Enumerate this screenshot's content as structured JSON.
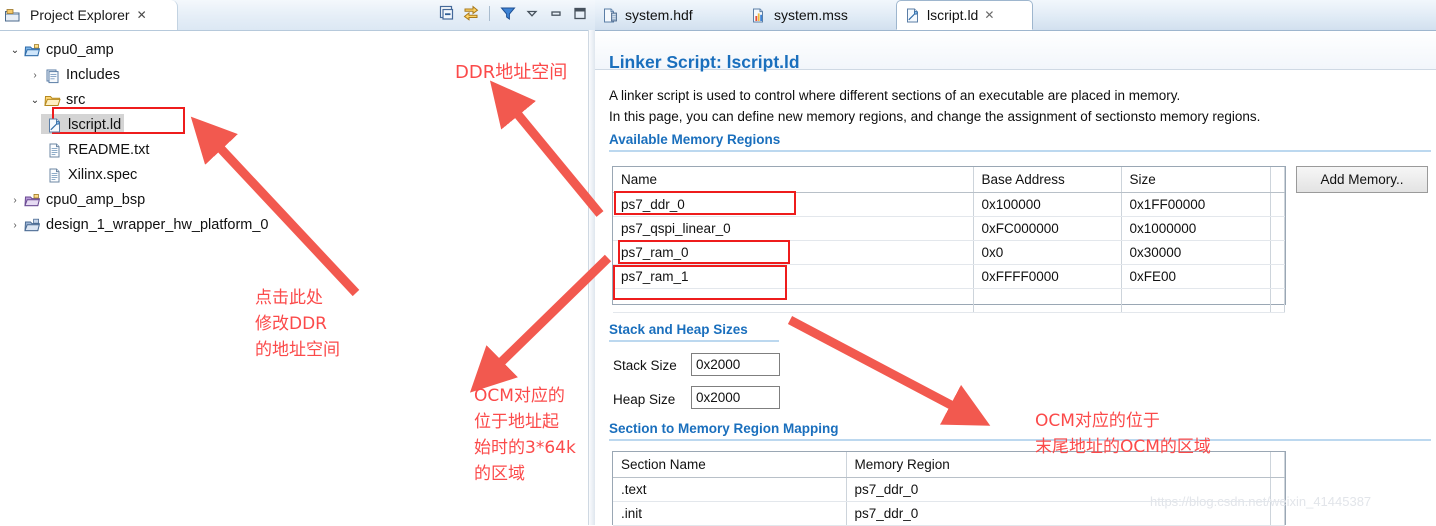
{
  "explorer": {
    "title": "Project Explorer",
    "close_label": "✕",
    "toolbar": [
      {
        "name": "collapse-all-icon",
        "tip": "Collapse All"
      },
      {
        "name": "link-with-editor-icon",
        "tip": "Link with Editor"
      },
      {
        "name": "filter-icon",
        "tip": "Filters"
      },
      {
        "name": "view-menu-icon",
        "tip": "View Menu"
      },
      {
        "name": "minimize-icon",
        "tip": "Minimize"
      },
      {
        "name": "maximize-icon",
        "tip": "Maximize"
      }
    ],
    "tree": [
      {
        "label": "cpu0_amp",
        "twisty": "open",
        "icon": "project-icon",
        "depth": 0
      },
      {
        "label": "Includes",
        "twisty": "closed",
        "icon": "includes-icon",
        "depth": 1
      },
      {
        "label": "src",
        "twisty": "open",
        "icon": "folder-icon",
        "depth": 1
      },
      {
        "label": "lscript.ld",
        "twisty": "none",
        "icon": "linker-script-icon",
        "depth": 2,
        "selected": true
      },
      {
        "label": "README.txt",
        "twisty": "none",
        "icon": "text-file-icon",
        "depth": 2
      },
      {
        "label": "Xilinx.spec",
        "twisty": "none",
        "icon": "text-file-icon",
        "depth": 2
      },
      {
        "label": "cpu0_amp_bsp",
        "twisty": "closed",
        "icon": "bsp-project-icon",
        "depth": 0
      },
      {
        "label": "design_1_wrapper_hw_platform_0",
        "twisty": "closed",
        "icon": "hw-platform-icon",
        "depth": 0
      }
    ]
  },
  "editor": {
    "tabs": [
      {
        "label": "system.hdf",
        "icon": "hdf-file-icon",
        "active": false
      },
      {
        "label": "system.mss",
        "icon": "mss-file-icon",
        "active": false
      },
      {
        "label": "lscript.ld",
        "icon": "linker-script-icon",
        "active": true,
        "close_label": "✕"
      }
    ],
    "page_title": "Linker Script: lscript.ld",
    "intro_line1": "A linker script is used to control where different sections of an executable are placed in memory.",
    "intro_line2": "In this page, you can define new memory regions, and change the assignment of sectionsto memory regions.",
    "memory_section": {
      "heading": "Available Memory Regions",
      "columns": [
        "Name",
        "Base Address",
        "Size"
      ],
      "rows": [
        {
          "name": "ps7_ddr_0",
          "base": "0x100000",
          "size": "0x1FF00000"
        },
        {
          "name": "ps7_qspi_linear_0",
          "base": "0xFC000000",
          "size": "0x1000000"
        },
        {
          "name": "ps7_ram_0",
          "base": "0x0",
          "size": "0x30000"
        },
        {
          "name": "ps7_ram_1",
          "base": "0xFFFF0000",
          "size": "0xFE00"
        },
        {
          "name": "",
          "base": "",
          "size": ""
        }
      ],
      "add_button": "Add Memory.."
    },
    "stack_heap": {
      "heading": "Stack and Heap Sizes",
      "stack_label": "Stack Size",
      "stack_value": "0x2000",
      "heap_label": "Heap Size",
      "heap_value": "0x2000"
    },
    "mapping_section": {
      "heading": "Section to Memory Region Mapping",
      "columns": [
        "Section Name",
        "Memory Region"
      ],
      "rows": [
        {
          "section": ".text",
          "region": "ps7_ddr_0"
        },
        {
          "section": ".init",
          "region": "ps7_ddr_0"
        }
      ]
    }
  },
  "annotations": {
    "color": "#fb4a4a",
    "highlight_color": "#ee1c1c",
    "ddr_note": "DDR地址空间",
    "click_note": "点击此处\n修改DDR\n的地址空间",
    "ocm_left_note": "OCM对应的\n位于地址起\n始时的3*64k\n的区域",
    "ocm_right_note": "OCM对应的位于\n末尾地址的OCM的区域"
  },
  "watermark": "https://blog.csdn.net/weixin_41445387"
}
